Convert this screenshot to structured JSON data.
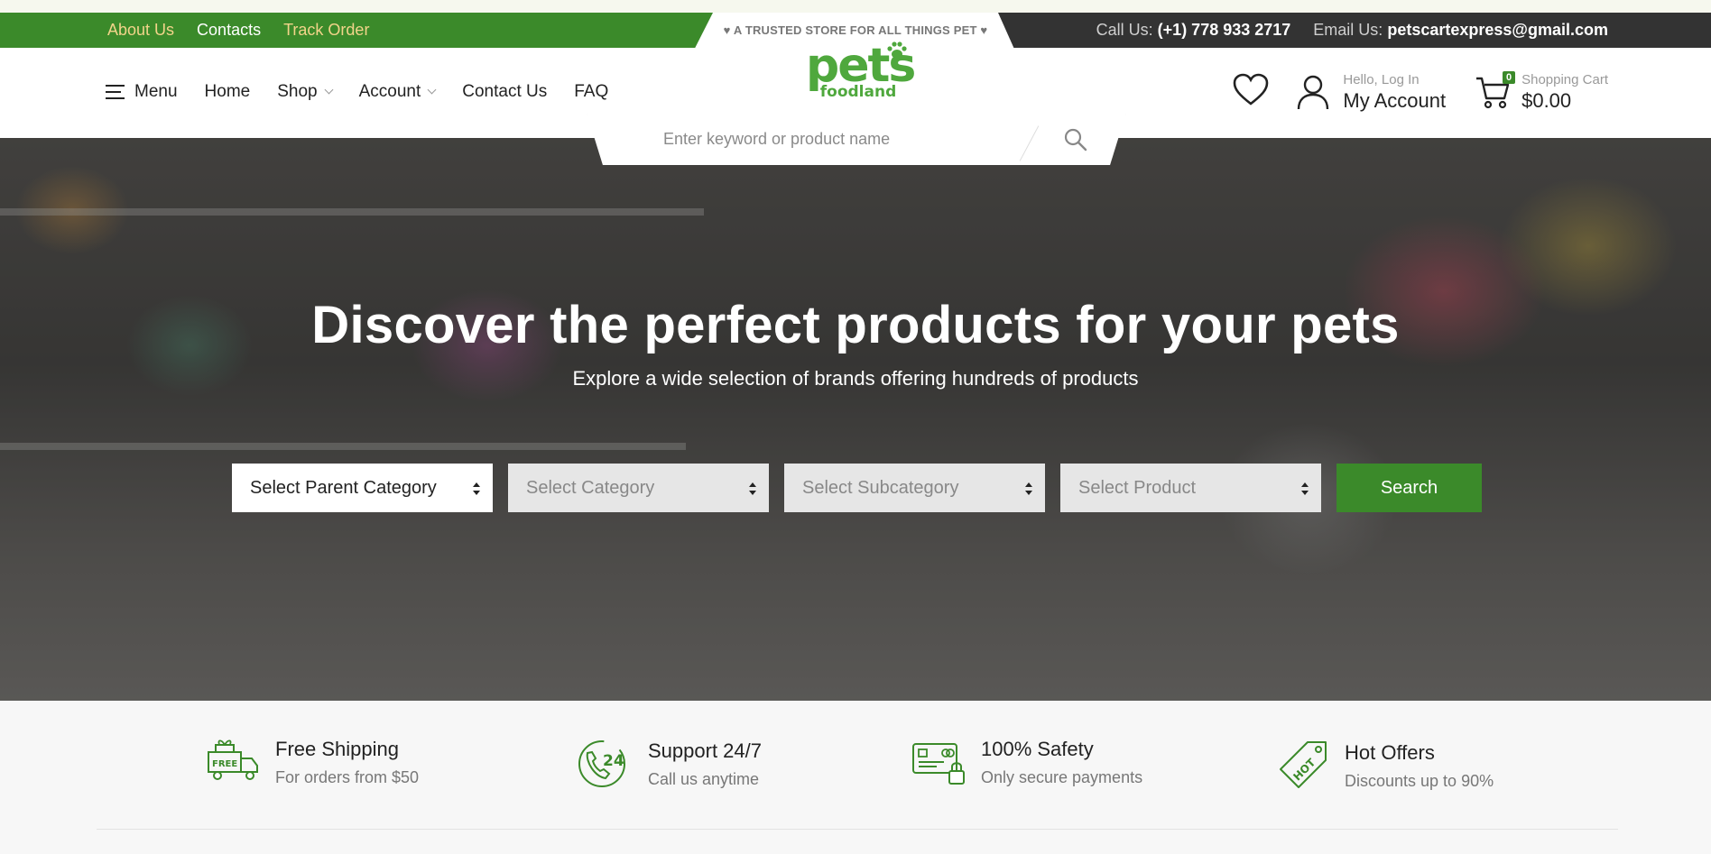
{
  "topbar": {
    "links": [
      "About Us",
      "Contacts",
      "Track Order"
    ],
    "tagline": "♥ A TRUSTED STORE FOR ALL THINGS PET ♥",
    "call_label": "Call Us:",
    "phone": "(+1) 778 933 2717",
    "email_label": "Email Us:",
    "email": "petscartexpress@gmail.com"
  },
  "nav": {
    "menu_label": "Menu",
    "items": [
      "Home",
      "Shop",
      "Account",
      "Contact Us",
      "FAQ"
    ]
  },
  "logo": {
    "main": "pets",
    "sub": "foodland"
  },
  "search": {
    "placeholder": "Enter keyword or product name"
  },
  "account": {
    "greeting": "Hello, Log In",
    "label": "My Account"
  },
  "cart": {
    "count": "0",
    "label": "Shopping Cart",
    "total": "$0.00"
  },
  "hero": {
    "title": "Discover the perfect products for your pets",
    "subtitle": "Explore a wide selection of brands offering hundreds of products",
    "filters": [
      "Select Parent Category",
      "Select Category",
      "Select Subcategory",
      "Select Product"
    ],
    "search_label": "Search"
  },
  "features": [
    {
      "title": "Free Shipping",
      "subtitle": "For orders from $50",
      "icon": "free-shipping-truck-icon"
    },
    {
      "title": "Support 24/7",
      "subtitle": "Call us anytime",
      "icon": "support-24-phone-icon"
    },
    {
      "title": "100% Safety",
      "subtitle": "Only secure payments",
      "icon": "secure-payment-card-icon"
    },
    {
      "title": "Hot Offers",
      "subtitle": "Discounts up to 90%",
      "icon": "hot-tag-icon"
    }
  ],
  "colors": {
    "brand_green": "#3b8a2a",
    "logo_green": "#4fa83d",
    "dark_bar": "#333333",
    "link_gold": "#f2d48a"
  }
}
